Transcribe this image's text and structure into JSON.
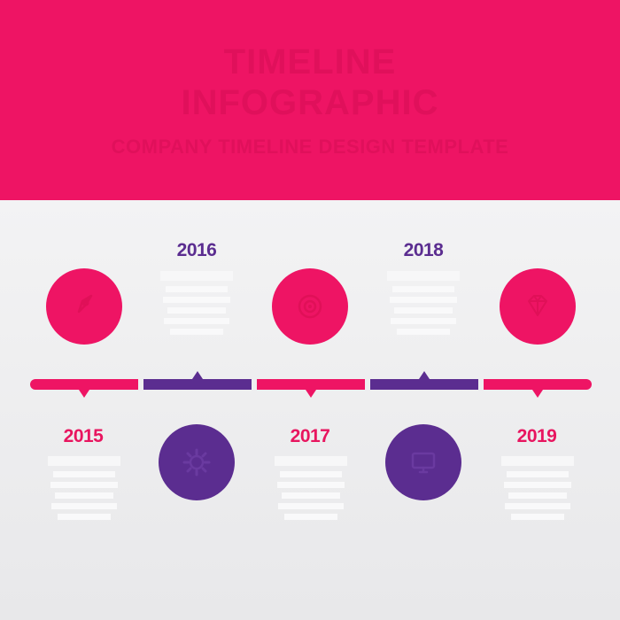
{
  "header": {
    "title_line1": "TIMELINE",
    "title_line2": "INFOGRAPHIC",
    "subtitle": "COMPANY TIMELINE DESIGN TEMPLATE"
  },
  "colors": {
    "header_background": "#ee1464",
    "pink": "#ee1464",
    "purple": "#5b2d90",
    "content_background": "#efeff0"
  },
  "milestones": [
    {
      "year": "2015",
      "color": "pink",
      "position": "below",
      "icon": "rocket-icon"
    },
    {
      "year": "2016",
      "color": "purple",
      "position": "above",
      "icon": "gear-icon"
    },
    {
      "year": "2017",
      "color": "pink",
      "position": "below",
      "icon": "target-icon"
    },
    {
      "year": "2018",
      "color": "purple",
      "position": "above",
      "icon": "monitor-icon"
    },
    {
      "year": "2019",
      "color": "pink",
      "position": "below",
      "icon": "diamond-icon"
    }
  ]
}
